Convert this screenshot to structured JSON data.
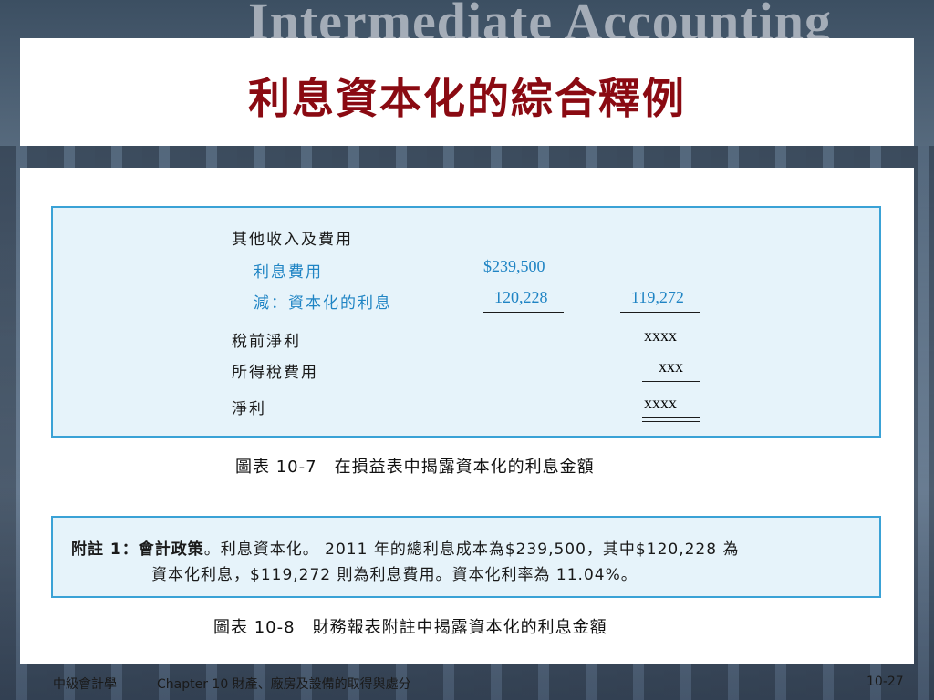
{
  "banner": "Intermediate Accounting",
  "title": "利息資本化的綜合釋例",
  "exhibit_10_7": {
    "heading": "其他收入及費用",
    "row_interest_label": "利息費用",
    "row_interest_value": "$239,500",
    "row_cap_label": "減：資本化的利息",
    "row_cap_value": "120,228",
    "row_cap_net": "119,272",
    "row_pretax_label": "稅前淨利",
    "row_pretax_value": "xxxx",
    "row_tax_label": "所得稅費用",
    "row_tax_value": "xxx",
    "row_net_label": "淨利",
    "row_net_value": "xxxx",
    "caption": "圖表 10-7　在損益表中揭露資本化的利息金額"
  },
  "exhibit_10_8": {
    "note_prefix": "附註 1：會計政策",
    "note_line1_rest": "。利息資本化。 2011 年的總利息成本為$239,500，其中$120,228 為",
    "note_line2": "資本化利息，$119,272 則為利息費用。資本化利率為 11.04%。",
    "caption": "圖表 10-8　財務報表附註中揭露資本化的利息金額"
  },
  "footer": {
    "course": "中級會計學",
    "chapter": "Chapter 10 財產、廠房及設備的取得與處分",
    "page": "10-27"
  }
}
